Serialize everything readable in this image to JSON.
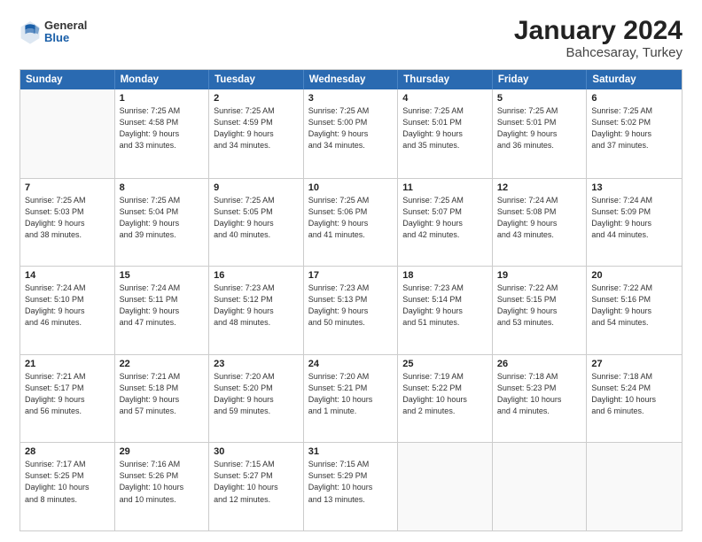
{
  "header": {
    "logo": {
      "general": "General",
      "blue": "Blue"
    },
    "title": "January 2024",
    "subtitle": "Bahcesaray, Turkey"
  },
  "weekdays": [
    "Sunday",
    "Monday",
    "Tuesday",
    "Wednesday",
    "Thursday",
    "Friday",
    "Saturday"
  ],
  "weeks": [
    [
      {
        "day": "",
        "info": ""
      },
      {
        "day": "1",
        "info": "Sunrise: 7:25 AM\nSunset: 4:58 PM\nDaylight: 9 hours\nand 33 minutes."
      },
      {
        "day": "2",
        "info": "Sunrise: 7:25 AM\nSunset: 4:59 PM\nDaylight: 9 hours\nand 34 minutes."
      },
      {
        "day": "3",
        "info": "Sunrise: 7:25 AM\nSunset: 5:00 PM\nDaylight: 9 hours\nand 34 minutes."
      },
      {
        "day": "4",
        "info": "Sunrise: 7:25 AM\nSunset: 5:01 PM\nDaylight: 9 hours\nand 35 minutes."
      },
      {
        "day": "5",
        "info": "Sunrise: 7:25 AM\nSunset: 5:01 PM\nDaylight: 9 hours\nand 36 minutes."
      },
      {
        "day": "6",
        "info": "Sunrise: 7:25 AM\nSunset: 5:02 PM\nDaylight: 9 hours\nand 37 minutes."
      }
    ],
    [
      {
        "day": "7",
        "info": "Sunrise: 7:25 AM\nSunset: 5:03 PM\nDaylight: 9 hours\nand 38 minutes."
      },
      {
        "day": "8",
        "info": "Sunrise: 7:25 AM\nSunset: 5:04 PM\nDaylight: 9 hours\nand 39 minutes."
      },
      {
        "day": "9",
        "info": "Sunrise: 7:25 AM\nSunset: 5:05 PM\nDaylight: 9 hours\nand 40 minutes."
      },
      {
        "day": "10",
        "info": "Sunrise: 7:25 AM\nSunset: 5:06 PM\nDaylight: 9 hours\nand 41 minutes."
      },
      {
        "day": "11",
        "info": "Sunrise: 7:25 AM\nSunset: 5:07 PM\nDaylight: 9 hours\nand 42 minutes."
      },
      {
        "day": "12",
        "info": "Sunrise: 7:24 AM\nSunset: 5:08 PM\nDaylight: 9 hours\nand 43 minutes."
      },
      {
        "day": "13",
        "info": "Sunrise: 7:24 AM\nSunset: 5:09 PM\nDaylight: 9 hours\nand 44 minutes."
      }
    ],
    [
      {
        "day": "14",
        "info": "Sunrise: 7:24 AM\nSunset: 5:10 PM\nDaylight: 9 hours\nand 46 minutes."
      },
      {
        "day": "15",
        "info": "Sunrise: 7:24 AM\nSunset: 5:11 PM\nDaylight: 9 hours\nand 47 minutes."
      },
      {
        "day": "16",
        "info": "Sunrise: 7:23 AM\nSunset: 5:12 PM\nDaylight: 9 hours\nand 48 minutes."
      },
      {
        "day": "17",
        "info": "Sunrise: 7:23 AM\nSunset: 5:13 PM\nDaylight: 9 hours\nand 50 minutes."
      },
      {
        "day": "18",
        "info": "Sunrise: 7:23 AM\nSunset: 5:14 PM\nDaylight: 9 hours\nand 51 minutes."
      },
      {
        "day": "19",
        "info": "Sunrise: 7:22 AM\nSunset: 5:15 PM\nDaylight: 9 hours\nand 53 minutes."
      },
      {
        "day": "20",
        "info": "Sunrise: 7:22 AM\nSunset: 5:16 PM\nDaylight: 9 hours\nand 54 minutes."
      }
    ],
    [
      {
        "day": "21",
        "info": "Sunrise: 7:21 AM\nSunset: 5:17 PM\nDaylight: 9 hours\nand 56 minutes."
      },
      {
        "day": "22",
        "info": "Sunrise: 7:21 AM\nSunset: 5:18 PM\nDaylight: 9 hours\nand 57 minutes."
      },
      {
        "day": "23",
        "info": "Sunrise: 7:20 AM\nSunset: 5:20 PM\nDaylight: 9 hours\nand 59 minutes."
      },
      {
        "day": "24",
        "info": "Sunrise: 7:20 AM\nSunset: 5:21 PM\nDaylight: 10 hours\nand 1 minute."
      },
      {
        "day": "25",
        "info": "Sunrise: 7:19 AM\nSunset: 5:22 PM\nDaylight: 10 hours\nand 2 minutes."
      },
      {
        "day": "26",
        "info": "Sunrise: 7:18 AM\nSunset: 5:23 PM\nDaylight: 10 hours\nand 4 minutes."
      },
      {
        "day": "27",
        "info": "Sunrise: 7:18 AM\nSunset: 5:24 PM\nDaylight: 10 hours\nand 6 minutes."
      }
    ],
    [
      {
        "day": "28",
        "info": "Sunrise: 7:17 AM\nSunset: 5:25 PM\nDaylight: 10 hours\nand 8 minutes."
      },
      {
        "day": "29",
        "info": "Sunrise: 7:16 AM\nSunset: 5:26 PM\nDaylight: 10 hours\nand 10 minutes."
      },
      {
        "day": "30",
        "info": "Sunrise: 7:15 AM\nSunset: 5:27 PM\nDaylight: 10 hours\nand 12 minutes."
      },
      {
        "day": "31",
        "info": "Sunrise: 7:15 AM\nSunset: 5:29 PM\nDaylight: 10 hours\nand 13 minutes."
      },
      {
        "day": "",
        "info": ""
      },
      {
        "day": "",
        "info": ""
      },
      {
        "day": "",
        "info": ""
      }
    ]
  ]
}
